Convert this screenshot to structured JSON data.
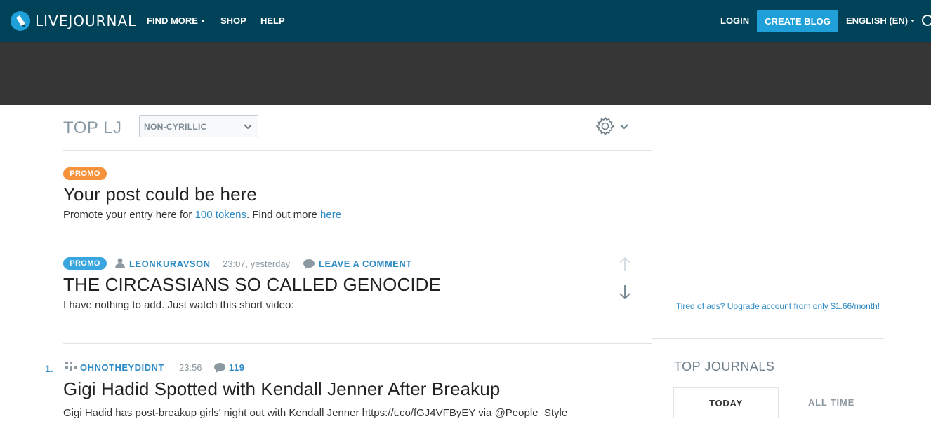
{
  "header": {
    "logo_text": "LIVEJOURNAL",
    "nav": {
      "find_more": "FIND MORE",
      "shop": "SHOP",
      "help": "HELP"
    },
    "login": "LOGIN",
    "create_blog": "CREATE BLOG",
    "language": "ENGLISH (EN)",
    "colors": {
      "bar": "#004359",
      "accent": "#1fa0d8"
    }
  },
  "toplj": {
    "title": "TOP LJ",
    "filter_selected": "NON-CYRILLIC"
  },
  "promo_slot": {
    "badge": "PROMO",
    "title": "Your post could be here",
    "text_before": "Promote your entry here for ",
    "tokens_link": "100 tokens",
    "text_middle": ". Find out more ",
    "here_link": "here"
  },
  "promo_post": {
    "badge": "PROMO",
    "author": "LEONKURAVSON",
    "time": "23:07, yesterday",
    "comment_link": "LEAVE A COMMENT",
    "title": "THE CIRCASSIANS SO CALLED GENOCIDE",
    "excerpt": "I have nothing to add. Just watch this short video:"
  },
  "post1": {
    "rank": "1.",
    "community": "OHNOTHEYDIDNT",
    "time": "23:56",
    "comments": "119",
    "title": "Gigi Hadid Spotted with Kendall Jenner After Breakup",
    "excerpt": "Gigi Hadid has post-breakup girls' night out with Kendall Jenner https://t.co/fGJ4VFByEY via @People_Style"
  },
  "sidebar": {
    "ad_note": "Tired of ads? Upgrade account from only $1.66/month!",
    "top_journals_title": "TOP JOURNALS",
    "tab_today": "TODAY",
    "tab_all_time": "ALL TIME"
  }
}
